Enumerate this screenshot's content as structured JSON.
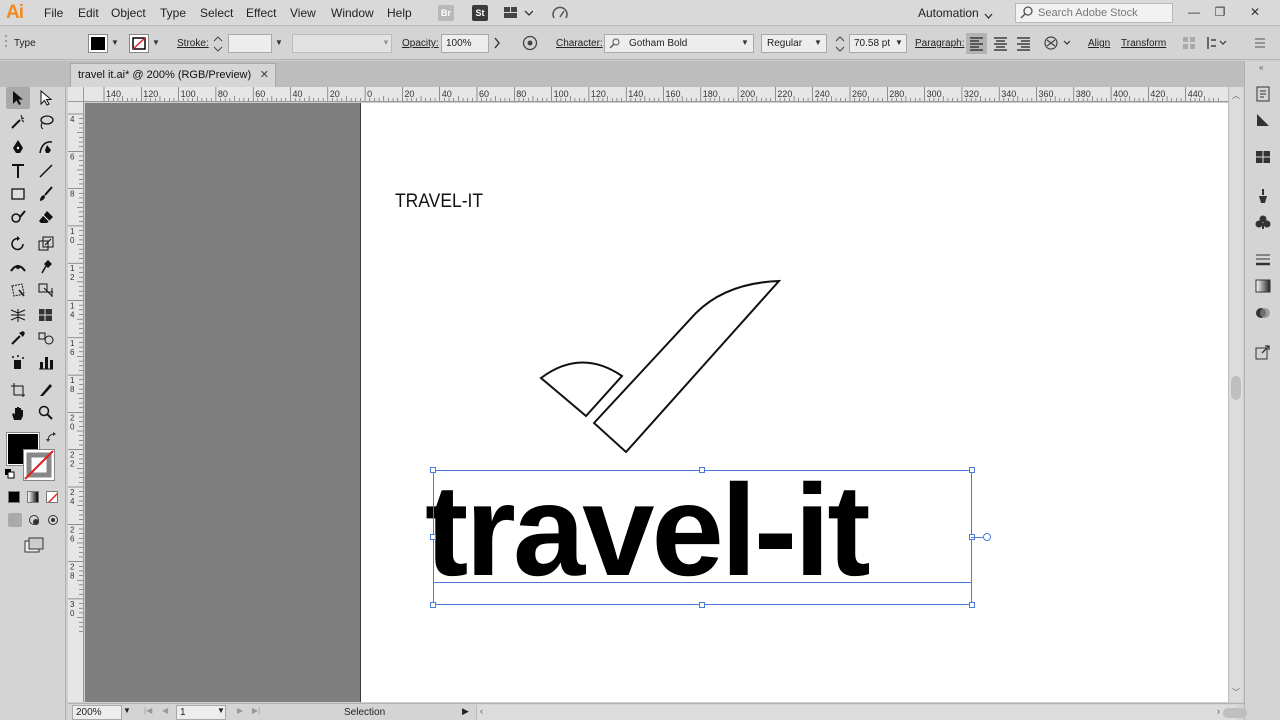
{
  "app": {
    "logo": "Ai"
  },
  "menu": [
    "File",
    "Edit",
    "Object",
    "Type",
    "Select",
    "Effect",
    "View",
    "Window",
    "Help"
  ],
  "menubar_icons": {
    "bridge": "Br",
    "stock": "St"
  },
  "workspace": "Automation",
  "search": {
    "placeholder": "Search Adobe Stock"
  },
  "window_buttons": {
    "minimize": "—",
    "restore": "❐",
    "close": "✕"
  },
  "control_bar": {
    "mode": "Type",
    "stroke_label": "Stroke:",
    "opacity_label": "Opacity:",
    "opacity_value": "100%",
    "character_label": "Character:",
    "font_family": "Gotham Bold",
    "font_style": "Regular",
    "font_size": "70.58 pt",
    "paragraph_label": "Paragraph:",
    "align_label": "Align",
    "transform_label": "Transform"
  },
  "document_tab": {
    "title": "travel it.ai* @ 200% (RGB/Preview)",
    "close": "✕"
  },
  "ruler_top": [
    "140",
    "120",
    "100",
    "80",
    "60",
    "40",
    "20",
    "0",
    "20",
    "40",
    "60",
    "80",
    "100",
    "120",
    "140",
    "160",
    "180",
    "200",
    "220",
    "240",
    "260",
    "280",
    "300",
    "320",
    "340",
    "360",
    "380",
    "400",
    "420",
    "440"
  ],
  "ruler_left": [
    "4",
    "6",
    "8",
    "1 0",
    "1 2",
    "1 4",
    "1 6",
    "1 8",
    "2 0",
    "2 2",
    "2 4",
    "2 6",
    "2 8",
    "3 0"
  ],
  "artboard": {
    "small_title": "TRAVEL-IT",
    "big_title": "travel-it"
  },
  "status_bar": {
    "zoom": "200%",
    "artboard_number": "1",
    "tool_name": "Selection"
  },
  "colors": {
    "fill": "#000000",
    "stroke": "none",
    "selection": "#4a7bd8",
    "logo": "#f08a1e"
  }
}
